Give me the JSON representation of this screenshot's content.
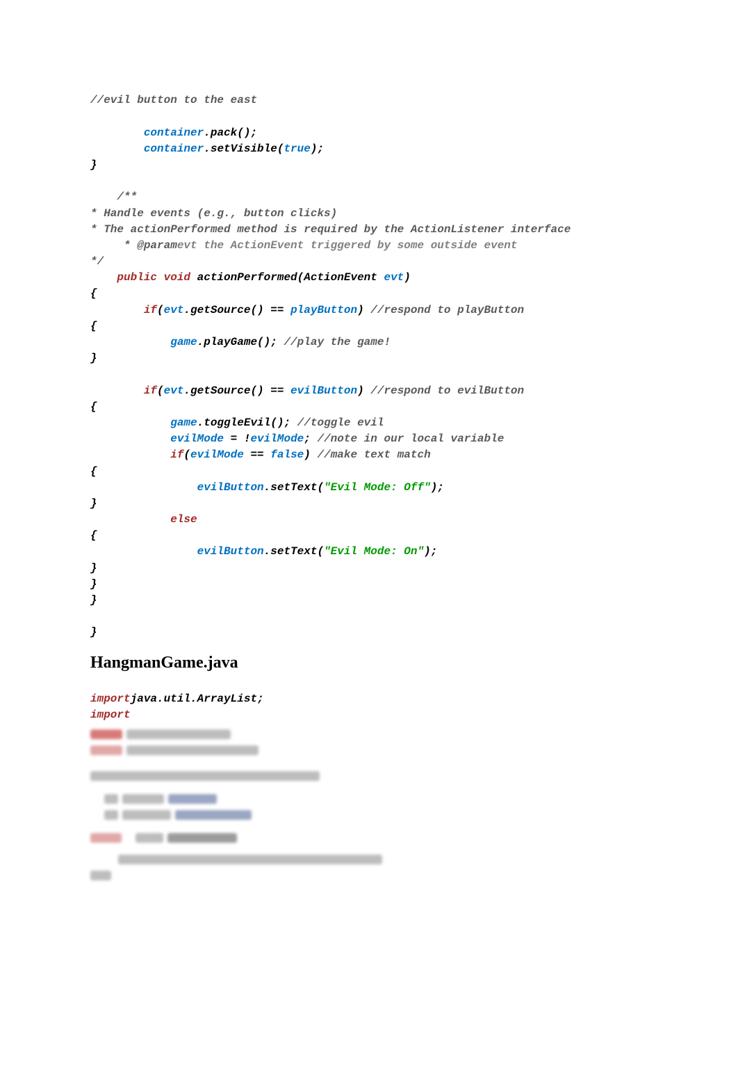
{
  "code": {
    "l1": "//evil button to the east",
    "l2a": "        container",
    "l2b": ".pack();",
    "l3a": "        container",
    "l3b": ".setVisible(",
    "l3c": "true",
    "l3d": ");",
    "l4": "}",
    "l5": "    /**",
    "l6": "* Handle events (e.g., button clicks)",
    "l7": "* The actionPerformed method is required by the ActionListener interface",
    "l8a": "     * @param",
    "l8b": "evt the ActionEvent triggered by some outside event",
    "l9": "*/",
    "l10a": "    public void ",
    "l10b": "actionPerformed(",
    "l10c": "ActionEvent ",
    "l10d": "evt",
    "l10e": ")",
    "l11": "{",
    "l12a": "        if",
    "l12b": "(",
    "l12c": "evt",
    "l12d": ".getSource() == ",
    "l12e": "playButton",
    "l12f": ") ",
    "l12g": "//respond to playButton",
    "l13": "{",
    "l14a": "            game",
    "l14b": ".playGame(); ",
    "l14c": "//play the game!",
    "l15": "}",
    "l16a": "        if",
    "l16b": "(",
    "l16c": "evt",
    "l16d": ".getSource() == ",
    "l16e": "evilButton",
    "l16f": ") ",
    "l16g": "//respond to evilButton",
    "l17": "{",
    "l18a": "            game",
    "l18b": ".toggleEvil(); ",
    "l18c": "//toggle evil",
    "l19a": "            evilMode ",
    "l19b": "= !",
    "l19c": "evilMode",
    "l19d": "; ",
    "l19e": "//note in our local variable",
    "l20a": "            if",
    "l20b": "(",
    "l20c": "evilMode ",
    "l20d": "== ",
    "l20e": "false",
    "l20f": ") ",
    "l20g": "//make text match",
    "l21": "{",
    "l22a": "                evilButton",
    "l22b": ".setText(",
    "l22c": "\"Evil Mode: Off\"",
    "l22d": ");",
    "l23": "}",
    "l24a": "            else",
    "l25": "{",
    "l26a": "                evilButton",
    "l26b": ".setText(",
    "l26c": "\"Evil Mode: On\"",
    "l26d": ");",
    "l27": "}",
    "l28": "}",
    "l29": "}",
    "l30": "}"
  },
  "heading": "HangmanGame.java",
  "code2": {
    "l1a": "import",
    "l1b": "java.util.ArrayList;",
    "l2a": "import"
  }
}
